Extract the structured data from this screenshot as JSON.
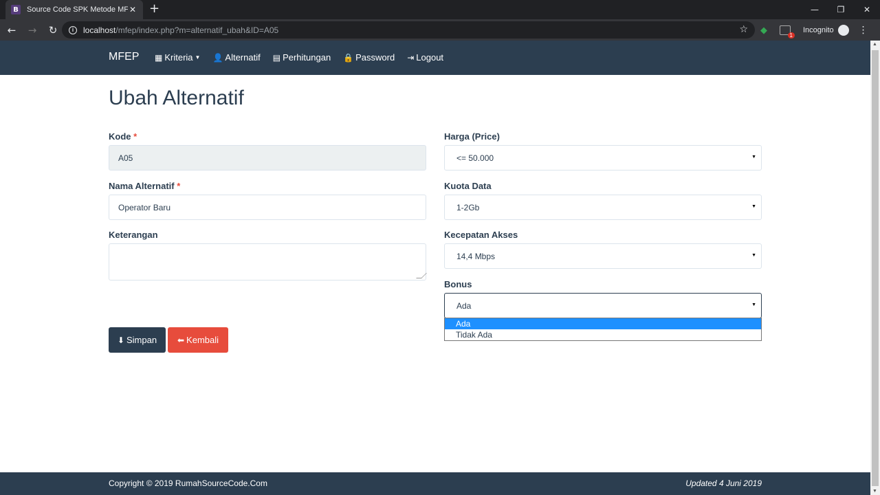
{
  "browser": {
    "tab_title": "Source Code SPK Metode MFEP",
    "tab_favicon": "B",
    "url_host": "localhost",
    "url_path": "/mfep/index.php?m=alternatif_ubah&ID=A05",
    "incognito_label": "Incognito",
    "ext_badge": "1"
  },
  "navbar": {
    "brand": "MFEP",
    "items": [
      {
        "label": "Kriteria",
        "icon": "grid-icon",
        "dropdown": true
      },
      {
        "label": "Alternatif",
        "icon": "user-icon"
      },
      {
        "label": "Perhitungan",
        "icon": "calendar-icon"
      },
      {
        "label": "Password",
        "icon": "lock-icon"
      },
      {
        "label": "Logout",
        "icon": "logout-icon"
      }
    ]
  },
  "page": {
    "title": "Ubah Alternatif"
  },
  "form": {
    "kode_label": "Kode",
    "kode_value": "A05",
    "nama_label": "Nama Alternatif",
    "nama_value": "Operator Baru",
    "keterangan_label": "Keterangan",
    "keterangan_value": "",
    "required_mark": "*",
    "harga_label": "Harga (Price)",
    "harga_value": "<= 50.000",
    "kuota_label": "Kuota Data",
    "kuota_value": "1-2Gb",
    "kecepatan_label": "Kecepatan Akses",
    "kecepatan_value": "14,4 Mbps",
    "bonus_label": "Bonus",
    "bonus_value": "Ada",
    "bonus_options": [
      "Ada",
      "Tidak Ada"
    ]
  },
  "buttons": {
    "save": "Simpan",
    "back": "Kembali"
  },
  "footer": {
    "copyright": "Copyright © 2019 RumahSourceCode.Com",
    "updated": "Updated 4 Juni 2019"
  }
}
